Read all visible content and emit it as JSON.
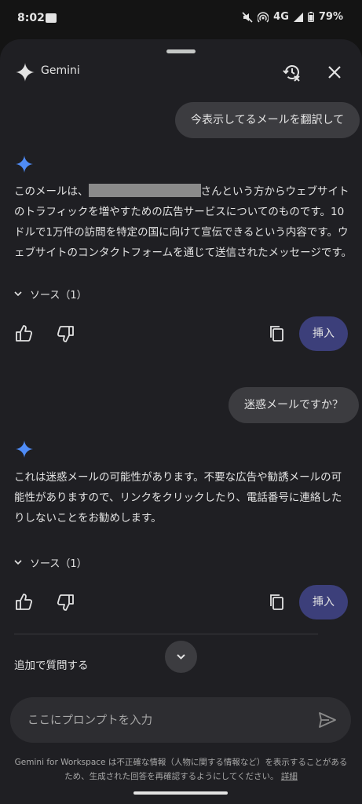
{
  "status": {
    "time": "8:02",
    "network": "4G",
    "battery": "79%"
  },
  "header": {
    "title": "Gemini"
  },
  "conversation": {
    "q1": "今表示してるメールを翻訳して",
    "a1": {
      "before": "このメールは、",
      "after": "さんという方からウェブサイトのトラフィックを増やすための広告サービスについてのものです。10ドルで1万件の訪問を特定の国に向けて宣伝できるという内容です。ウェブサイトのコンタクトフォームを通じて送信されたメッセージです。",
      "sources": "ソース（1）",
      "insert": "挿入"
    },
    "q2": "迷惑メールですか？",
    "a2": {
      "text": "これは迷惑メールの可能性があります。不要な広告や勧誘メールの可能性がありますので、リンクをクリックしたり、電話番号に連絡したりしないことをお勧めします。",
      "sources": "ソース（1）",
      "insert": "挿入"
    }
  },
  "followup": "追加で質問する",
  "prompt": {
    "placeholder": "ここにプロンプトを入力"
  },
  "disclaimer": {
    "text": "Gemini for Workspace は不正確な情報（人物に関する情報など）を表示することがあるため、生成された回答を再確認するようにしてください。",
    "link": "詳細"
  },
  "colors": {
    "accent_button": "#3c3f7a",
    "spark": "#4f8cf7",
    "background": "#1f1f23"
  },
  "icons": [
    "gemini-spark-icon",
    "history-off-icon",
    "close-icon",
    "chevron-down-icon",
    "thumbs-up-icon",
    "thumbs-down-icon",
    "copy-icon",
    "send-icon"
  ]
}
